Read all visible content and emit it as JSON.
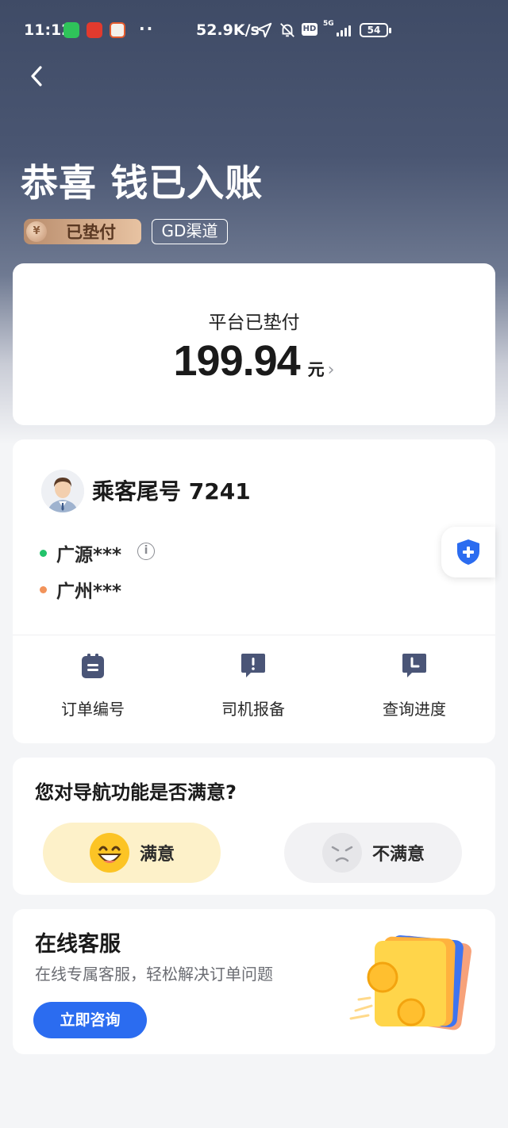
{
  "status_bar": {
    "time": "11:12",
    "app_icons": [
      "phone-app-icon",
      "news-app-icon",
      "yangguang-app-icon"
    ],
    "dots": "··",
    "net_speed": "52.9K/s",
    "network_label": "5G",
    "hd_label": "HD",
    "battery": "54"
  },
  "header": {
    "title": "恭喜 钱已入账",
    "pay_badge": "已垫付",
    "coin_symbol": "¥",
    "channel_badge": "GD渠道"
  },
  "amount_card": {
    "label": "平台已垫付",
    "amount": "199.94",
    "unit": "元",
    "chevron": "›"
  },
  "trip_card": {
    "passenger": "乘客尾号 7241",
    "origin": "广源***",
    "destination": "广州***",
    "info_symbol": "i",
    "origin_dot_color": "#22c36b",
    "destination_dot_color": "#f2935a",
    "actions": [
      {
        "label": "订单编号",
        "icon": "clipboard-icon"
      },
      {
        "label": "司机报备",
        "icon": "alert-chat-icon"
      },
      {
        "label": "查询进度",
        "icon": "clock-chat-icon"
      }
    ]
  },
  "safety": {
    "icon": "shield-plus-icon",
    "color": "#2b6cf0"
  },
  "survey": {
    "question": "您对导航功能是否满意?",
    "satisfied": "满意",
    "unsatisfied": "不满意"
  },
  "service": {
    "title": "在线客服",
    "subtitle": "在线专属客服，轻松解决订单问题",
    "button": "立即咨询",
    "accent": "#2b6cf0"
  }
}
